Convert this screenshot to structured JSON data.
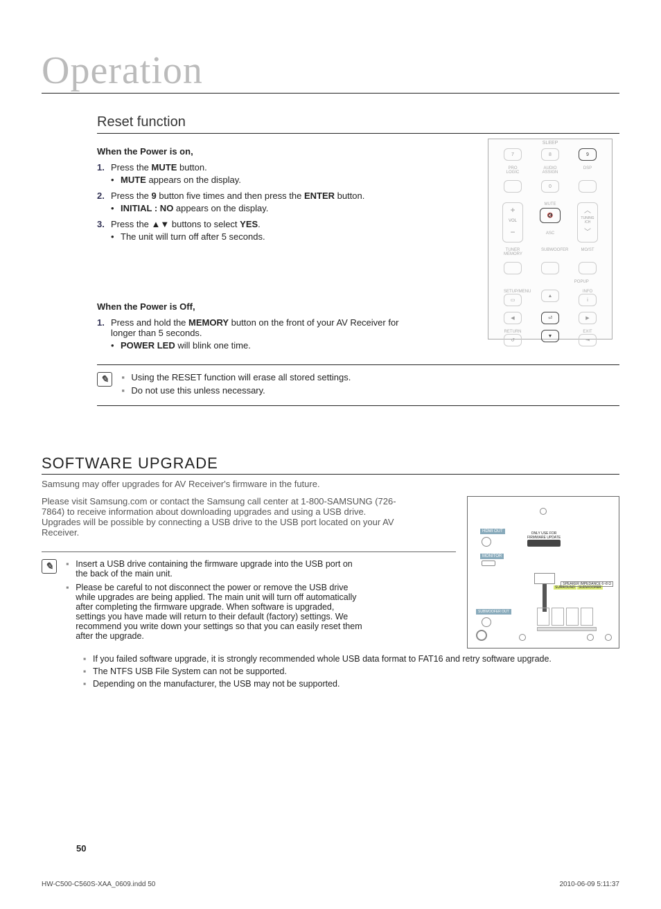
{
  "chapter": "Operation",
  "reset": {
    "heading": "Reset function",
    "power_on_label": "When the Power is on,",
    "s1_pre": "Press the ",
    "s1_b": "MUTE",
    "s1_post": " button.",
    "s1_sub_b": "MUTE",
    "s1_sub_post": " appears on the display.",
    "s2_pre": "Press the ",
    "s2_b1": "9",
    "s2_mid": " button five times and then press the ",
    "s2_b2": "ENTER",
    "s2_post": " button.",
    "s2_sub_b": "INITIAL : NO",
    "s2_sub_post": " appears on the display.",
    "s3_pre": "Press the ▲▼ buttons to select ",
    "s3_b": "YES",
    "s3_post": ".",
    "s3_sub": "The unit will turn off after 5 seconds.",
    "power_off_label": "When the Power is Off,",
    "off1_pre": "Press and hold the ",
    "off1_b": "MEMORY",
    "off1_post": " button on the front of your AV Receiver for longer than 5 seconds.",
    "off1_sub_b": "POWER LED",
    "off1_sub_post": " will blink one time.",
    "note1": "Using the RESET function will erase all stored settings.",
    "note2": "Do not use this unless necessary."
  },
  "upgrade": {
    "heading": "SOFTWARE UPGRADE",
    "p1": "Samsung may offer upgrades for AV Receiver's firmware in the future.",
    "p2": "Please visit Samsung.com or contact the Samsung call center at 1-800-SAMSUNG (726-7864) to receive information about downloading upgrades and using a USB drive. Upgrades will be possible by connecting a USB drive to the USB port located on your AV Receiver.",
    "n1": "Insert a USB drive containing the firmware upgrade into the USB port on the back of the main unit.",
    "n2": "Please be careful to not disconnect the power or remove the USB drive while upgrades are being applied. The main unit will turn off automatically after completing the firmware upgrade. When software is upgraded, settings you have made will return to their default (factory) settings. We recommend you write down your settings so that you can easily reset them after the upgrade.",
    "n3": "If you failed software upgrade, it is strongly recommended whole USB data format to FAT16 and retry software upgrade.",
    "n4": "The NTFS USB File System can not be supported.",
    "n5": "Depending on the manufacturer, the USB may not be supported."
  },
  "remote": {
    "sleep": "SLEEP",
    "b7": "7",
    "b8": "8",
    "b9": "9",
    "b0": "0",
    "prologic": "PRO LOGIC",
    "audioassign": "AUDIO ASSIGN",
    "dsp": "DSP",
    "mute": "MUTE",
    "vol": "VOL",
    "tuning": "TUNING /CH",
    "asc": "ASC",
    "tunermem": "TUNER MEMORY",
    "subwoofer": "SUBWOOFER",
    "mo": "MO/ST",
    "popup": "POPUP",
    "setup": "SETUP/MENU",
    "info": "INFO",
    "return": "RETURN",
    "exit": "EXIT"
  },
  "diagram": {
    "usb_label": "ONLY USE FOR FIRMWARE UPDATE",
    "hdmi": "HDMI OUT",
    "monitor": "MONITOR",
    "surround": "SURROUND",
    "subw": "SUBWOOFER",
    "subout": "SUBWOOFER OUT",
    "speaker": "SPEAKER IMPEDANCE 6~8 Ω"
  },
  "footer": {
    "page": "50",
    "file": "HW-C500-C560S-XAA_0609.indd   50",
    "date": "2010-06-09    5:11:37"
  }
}
